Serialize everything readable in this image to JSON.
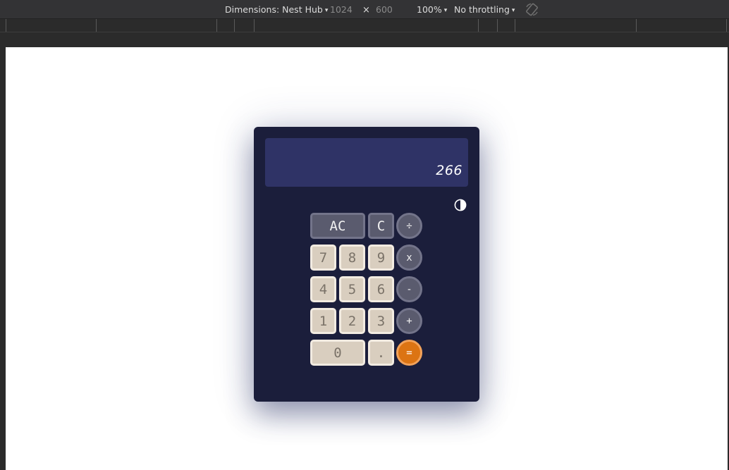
{
  "devtools": {
    "device_label": "Dimensions: Nest Hub",
    "width": "1024",
    "times": "×",
    "height": "600",
    "zoom": "100%",
    "throttling": "No throttling",
    "caret": "▾"
  },
  "calculator": {
    "display_value": "266",
    "theme_icon": "contrast-icon",
    "keys": {
      "ac": "AC",
      "c": "C",
      "divide": "÷",
      "seven": "7",
      "eight": "8",
      "nine": "9",
      "multiply": "x",
      "four": "4",
      "five": "5",
      "six": "6",
      "minus": "-",
      "one": "1",
      "two": "2",
      "three": "3",
      "plus": "+",
      "zero": "0",
      "dot": ".",
      "equals": "="
    },
    "colors": {
      "body": "#1b1e3b",
      "display": "#2f3366",
      "number_key": "#d9cebf",
      "function_key": "#5a5b6e",
      "equals_key": "#dc7413"
    }
  }
}
